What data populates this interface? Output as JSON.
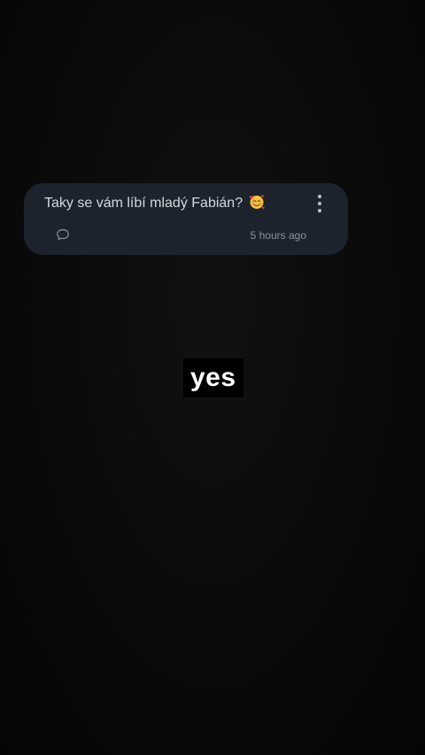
{
  "question_card": {
    "text": "Taky se vám líbí mladý Fabián?",
    "emoji": "smiling-face-with-hearts",
    "timestamp": "5 hours ago",
    "more_icon": "more-vertical-icon",
    "reply_icon": "speech-bubble-icon",
    "background_color": "#1d232c"
  },
  "caption": {
    "text": "yes"
  }
}
